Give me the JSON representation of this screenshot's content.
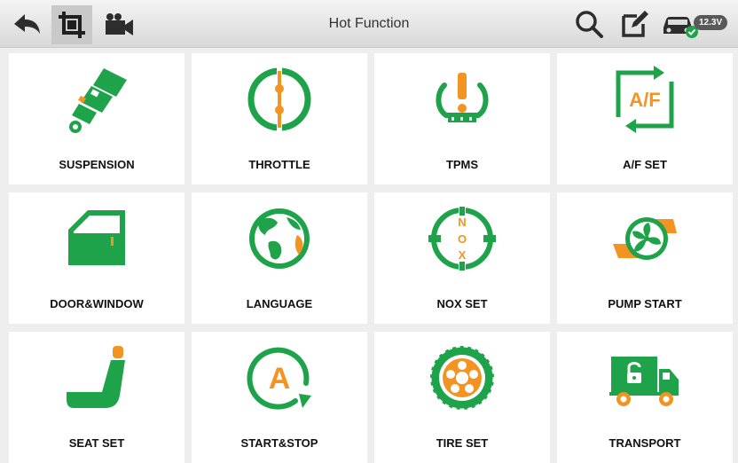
{
  "header": {
    "title": "Hot Function",
    "voltage": "12.3V"
  },
  "tiles": [
    {
      "label": "SUSPENSION"
    },
    {
      "label": "THROTTLE"
    },
    {
      "label": "TPMS"
    },
    {
      "label": "A/F SET"
    },
    {
      "label": "DOOR&WINDOW"
    },
    {
      "label": "LANGUAGE"
    },
    {
      "label": "NOX SET"
    },
    {
      "label": "PUMP START"
    },
    {
      "label": "SEAT SET"
    },
    {
      "label": "START&STOP"
    },
    {
      "label": "TIRE SET"
    },
    {
      "label": "TRANSPORT"
    }
  ],
  "icon_text": {
    "af": "A/F",
    "nox": [
      "N",
      "O",
      "X"
    ],
    "start": "A"
  },
  "colors": {
    "green": "#1fa34a",
    "orange": "#f39422",
    "gray": "#3a3a3a"
  },
  "icons": [
    "back-icon",
    "screenshot-icon",
    "video-record-icon",
    "search-icon",
    "edit-icon",
    "vehicle-status-icon"
  ]
}
